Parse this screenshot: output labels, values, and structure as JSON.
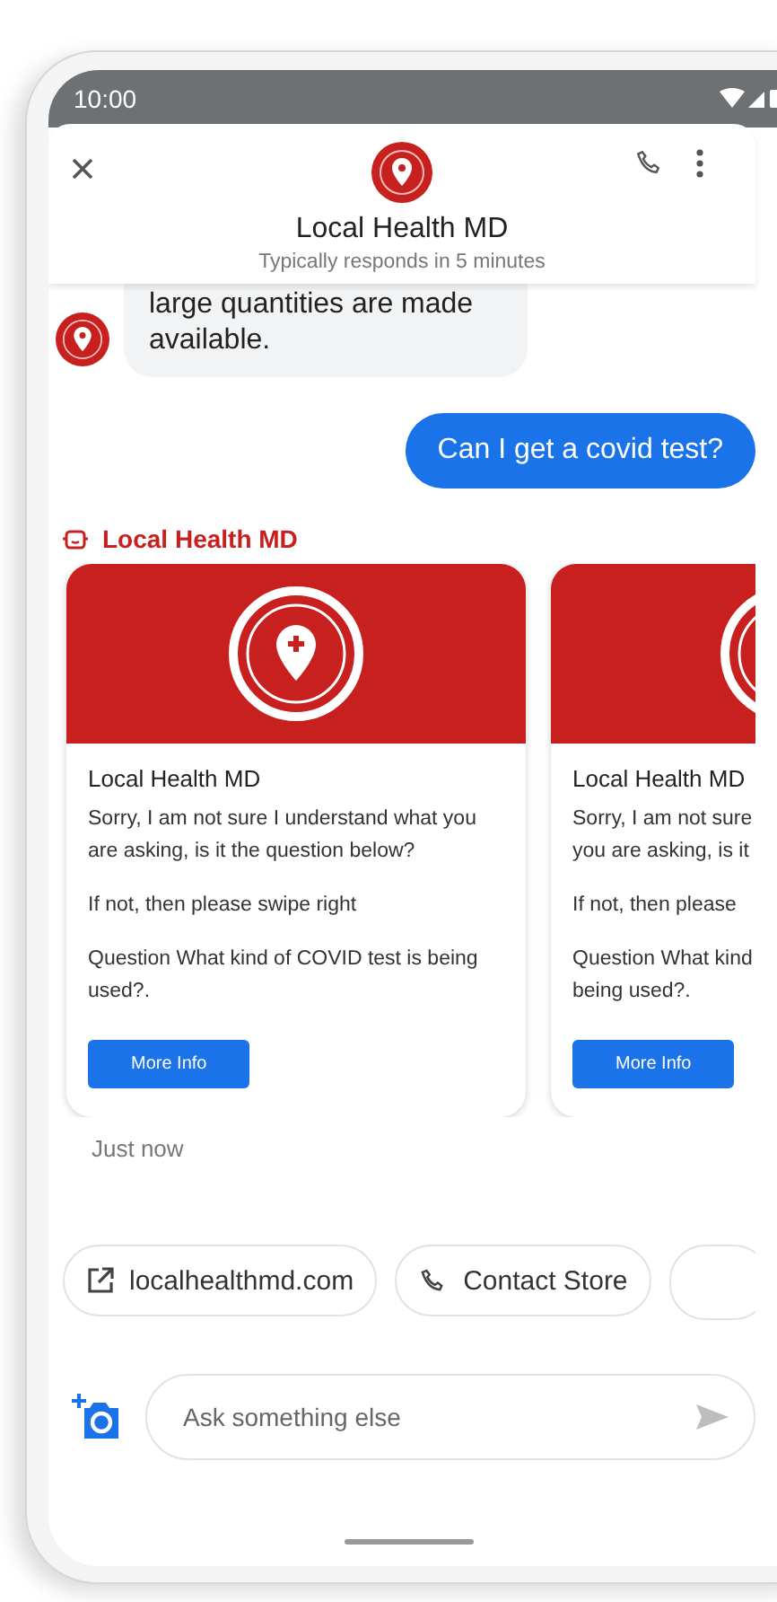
{
  "status_bar": {
    "time": "10:00"
  },
  "header": {
    "title": "Local Health MD",
    "subtitle": "Typically responds in 5 minutes"
  },
  "messages": [
    {
      "kind": "incoming",
      "lines": [
        "large quantities are made",
        "available."
      ]
    },
    {
      "kind": "outgoing",
      "lines": [
        "Can I get a covid test?"
      ]
    }
  ],
  "sender_label": "Local Health MD",
  "cards": [
    {
      "title": "Local Health MD",
      "paragraphs": [
        "Sorry, I am not sure I understand what you are asking, is it the question below?",
        "If not, then please swipe right",
        "Question What kind of COVID test is being used?."
      ],
      "button": "More Info"
    },
    {
      "title": "Local Health MD",
      "paragraphs": [
        "Sorry, I am not sure\nyou are asking, is it",
        "If not, then please",
        "Question What kind\nbeing used?."
      ],
      "button": "More Info"
    }
  ],
  "timestamp": "Just now",
  "chips": [
    {
      "kind": "link",
      "label": "localhealthmd.com"
    },
    {
      "kind": "call",
      "label": "Contact Store"
    },
    {
      "kind": "partial"
    }
  ],
  "composer": {
    "placeholder": "Ask something else"
  }
}
